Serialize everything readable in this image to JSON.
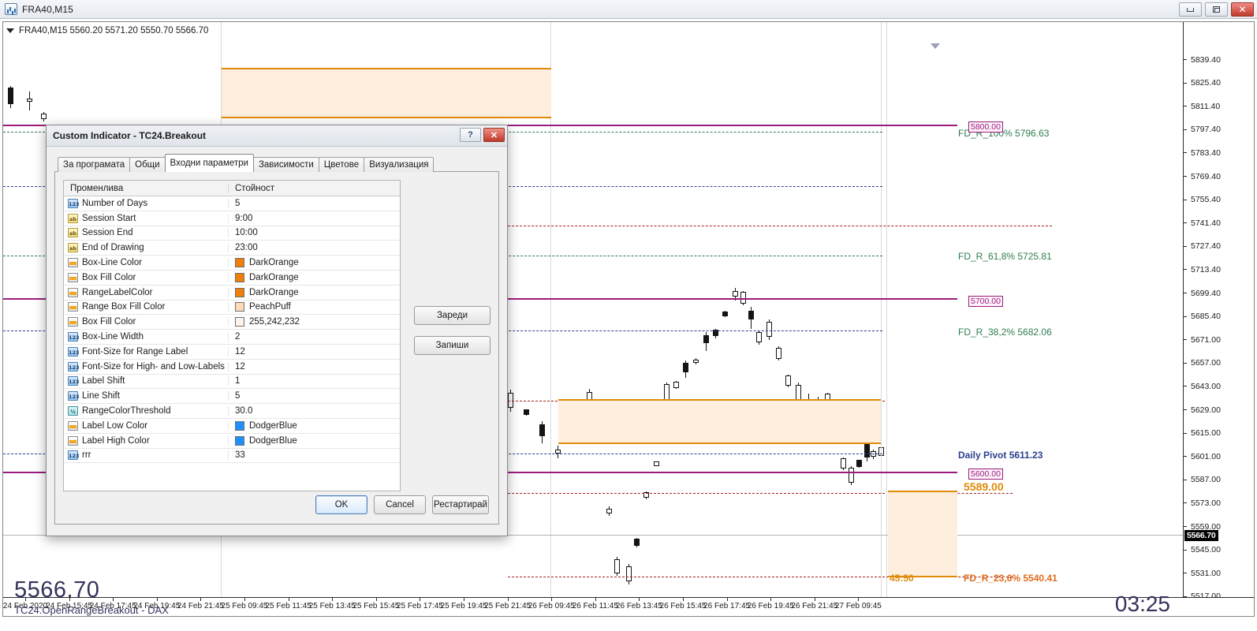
{
  "window": {
    "title": "FRA40,M15",
    "icon": "chart-window-icon",
    "controls": [
      {
        "name": "minimize",
        "glyph": "minimize-icon"
      },
      {
        "name": "maximize",
        "glyph": "maximize-icon"
      },
      {
        "name": "close",
        "glyph": "close-icon"
      }
    ]
  },
  "chart": {
    "symbol_line": "FRA40,M15  5560.20 5571.20 5550.70 5566.70",
    "big_price": "5566.70",
    "indicator_name": "TC24.OpenRangeBreakout - DAX",
    "clock": "03:25",
    "last_price_tag": "5566.70",
    "price_axis": [
      "5839.40",
      "5825.40",
      "5811.40",
      "5797.40",
      "5783.40",
      "5769.40",
      "5755.40",
      "5741.40",
      "5727.40",
      "5713.40",
      "5699.40",
      "5685.40",
      "5671.00",
      "5657.00",
      "5643.00",
      "5629.00",
      "5615.00",
      "5601.00",
      "5587.00",
      "5573.00",
      "5559.00",
      "5545.00",
      "5531.00",
      "5517.00"
    ],
    "time_axis": [
      "24 Feb 2020",
      "24 Feb 15:45",
      "24 Feb 17:45",
      "24 Feb 19:45",
      "24 Feb 21:45",
      "25 Feb 09:45",
      "25 Feb 11:45",
      "25 Feb 13:45",
      "25 Feb 15:45",
      "25 Feb 17:45",
      "25 Feb 19:45",
      "25 Feb 21:45",
      "26 Feb 09:45",
      "26 Feb 11:45",
      "26 Feb 13:45",
      "26 Feb 15:45",
      "26 Feb 17:45",
      "26 Feb 19:45",
      "26 Feb 21:45",
      "27 Feb 09:45"
    ],
    "annotations": [
      {
        "name": "fib-100",
        "text": "FD_R_100%  5796.63",
        "color": "#2e7d4f"
      },
      {
        "name": "fib-618",
        "text": "FD_R_61,8%  5725.81",
        "color": "#2e7d4f"
      },
      {
        "name": "fib-382",
        "text": "FD_R_38,2%  5682.06",
        "color": "#2e7d4f"
      },
      {
        "name": "daily-pivot",
        "text": "Daily Pivot  5611.23",
        "color": "#2b3f8c"
      },
      {
        "name": "range-high-label",
        "text": "5589.00",
        "color": "#e08a0a"
      },
      {
        "name": "fib-low-overlap",
        "text": "FD_R_23,6%  5540.41",
        "color": "#e06c1a"
      },
      {
        "name": "range-timer",
        "text": "45:50",
        "color": "#e08a0a"
      }
    ],
    "price_tags": [
      {
        "name": "tag-5800",
        "text": "5800.00"
      },
      {
        "name": "tag-5700",
        "text": "5700.00"
      },
      {
        "name": "tag-5600",
        "text": "5600.00"
      }
    ],
    "colors": {
      "magenta_line": "#9b1b7d",
      "box_line": "#e08a0a",
      "box_fill": "#fdeedd",
      "green_dash": "#2e7d4f",
      "navy_dash": "#2b3f8c",
      "red_dash": "#a32020"
    }
  },
  "dialog": {
    "title": "Custom Indicator - TC24.Breakout",
    "help_label": "?",
    "close_label": "✕",
    "tabs": [
      {
        "name": "tab-about",
        "label": "За програмата",
        "active": false
      },
      {
        "name": "tab-common",
        "label": "Общи",
        "active": false
      },
      {
        "name": "tab-inputs",
        "label": "Входни параметри",
        "active": true
      },
      {
        "name": "tab-dependencies",
        "label": "Зависимости",
        "active": false
      },
      {
        "name": "tab-colors",
        "label": "Цветове",
        "active": false
      },
      {
        "name": "tab-visualization",
        "label": "Визуализация",
        "active": false
      }
    ],
    "grid": {
      "headers": [
        "Променлива",
        "Стойност"
      ],
      "rows": [
        {
          "icon": "int",
          "name": "Number of Days",
          "value": "5"
        },
        {
          "icon": "str",
          "name": "Session Start",
          "value": "9:00"
        },
        {
          "icon": "str",
          "name": "Session End",
          "value": "10:00"
        },
        {
          "icon": "str",
          "name": "End of Drawing",
          "value": "23:00"
        },
        {
          "icon": "col",
          "name": "Box-Line Color",
          "value": "DarkOrange",
          "swatch": "#ee7f0a"
        },
        {
          "icon": "col",
          "name": "Box Fill Color",
          "value": "DarkOrange",
          "swatch": "#ee7f0a"
        },
        {
          "icon": "col",
          "name": "RangeLabelColor",
          "value": "DarkOrange",
          "swatch": "#ee7f0a"
        },
        {
          "icon": "col",
          "name": "Range Box Fill Color",
          "value": "PeachPuff",
          "swatch": "#ffdab9"
        },
        {
          "icon": "col",
          "name": "Box Fill Color",
          "value": "255,242,232",
          "swatch": "#fff2e8"
        },
        {
          "icon": "int",
          "name": "Box-Line Width",
          "value": "2"
        },
        {
          "icon": "int",
          "name": "Font-Size for Range Label",
          "value": "12"
        },
        {
          "icon": "int",
          "name": "Font-Size for High- and Low-Labels",
          "value": "12"
        },
        {
          "icon": "int",
          "name": "Label Shift",
          "value": "1"
        },
        {
          "icon": "int",
          "name": "Line Shift",
          "value": "5"
        },
        {
          "icon": "dbl",
          "name": "RangeColorThreshold",
          "value": "30.0"
        },
        {
          "icon": "col",
          "name": "Label Low Color",
          "value": "DodgerBlue",
          "swatch": "#1e90ff"
        },
        {
          "icon": "col",
          "name": "Label High Color",
          "value": "DodgerBlue",
          "swatch": "#1e90ff"
        },
        {
          "icon": "int",
          "name": "rrr",
          "value": "33"
        }
      ]
    },
    "side_buttons": [
      {
        "name": "load-button",
        "label": "Зареди"
      },
      {
        "name": "save-button",
        "label": "Запиши"
      }
    ],
    "bottom_buttons": [
      {
        "name": "ok-button",
        "label": "OK"
      },
      {
        "name": "cancel-button",
        "label": "Cancel"
      },
      {
        "name": "restart-button",
        "label": "Рестартирай"
      }
    ]
  }
}
